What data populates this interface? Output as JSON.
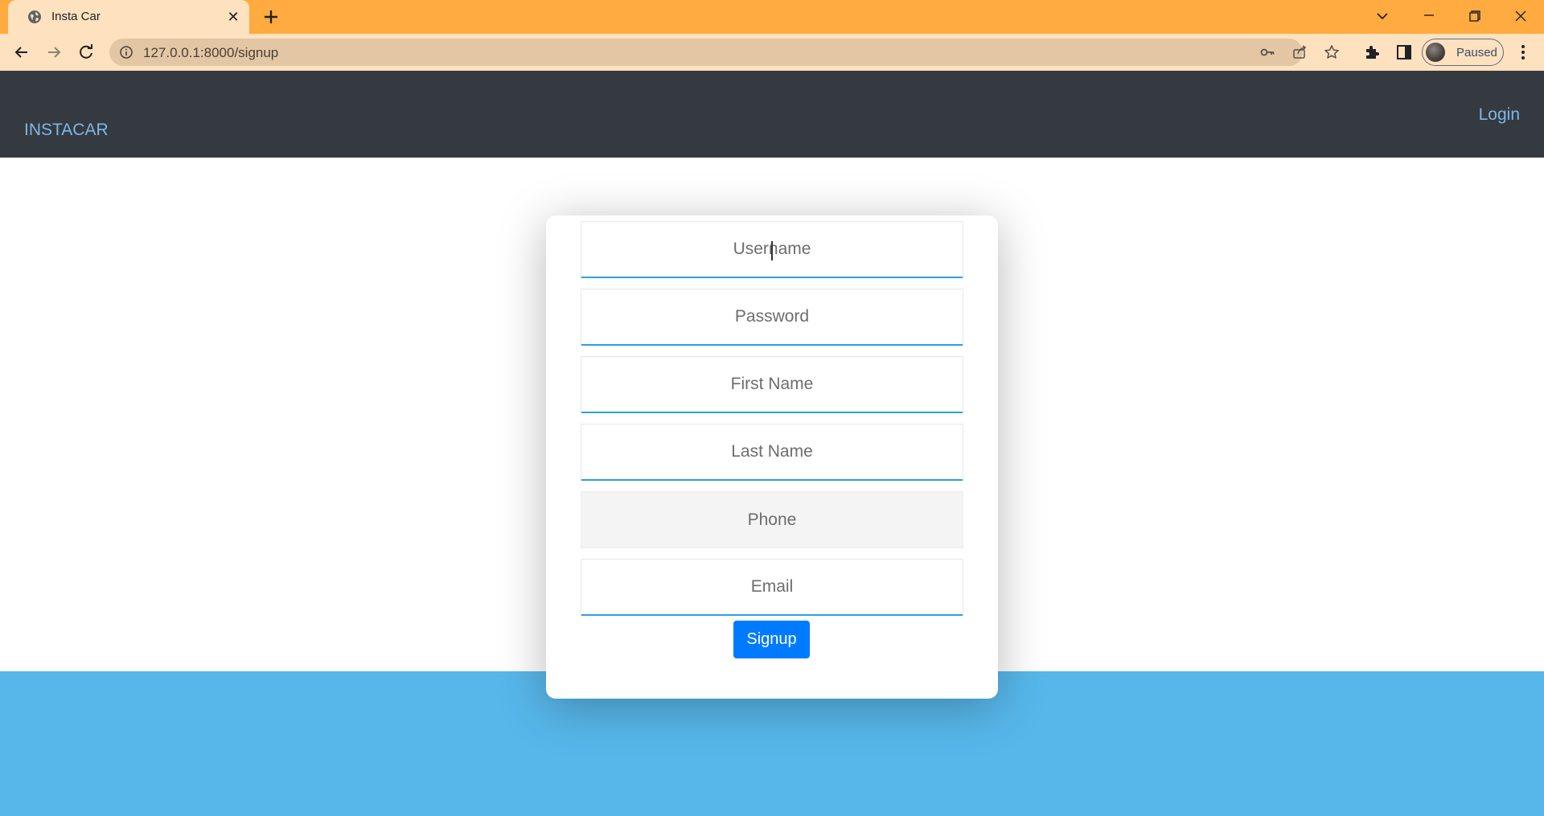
{
  "browser": {
    "tab_title": "Insta Car",
    "url": "127.0.0.1:8000/signup",
    "profile_label": "Paused",
    "theme_colors": {
      "tabstrip": "#ffab40",
      "toolbar": "#fee1be",
      "omnibox": "#e3c6a4"
    }
  },
  "navbar": {
    "brand": "INSTACAR",
    "login_label": "Login",
    "background": "#343a40",
    "link_color": "#7fb7e6"
  },
  "form": {
    "fields": [
      {
        "placeholder": "Username",
        "value": ""
      },
      {
        "placeholder": "Password",
        "value": ""
      },
      {
        "placeholder": "First Name",
        "value": ""
      },
      {
        "placeholder": "Last Name",
        "value": ""
      },
      {
        "placeholder": "Phone",
        "value": ""
      },
      {
        "placeholder": "Email",
        "value": ""
      }
    ],
    "submit_label": "Signup",
    "submit_color": "#007bff",
    "accent_band_color": "#57b7ea"
  }
}
